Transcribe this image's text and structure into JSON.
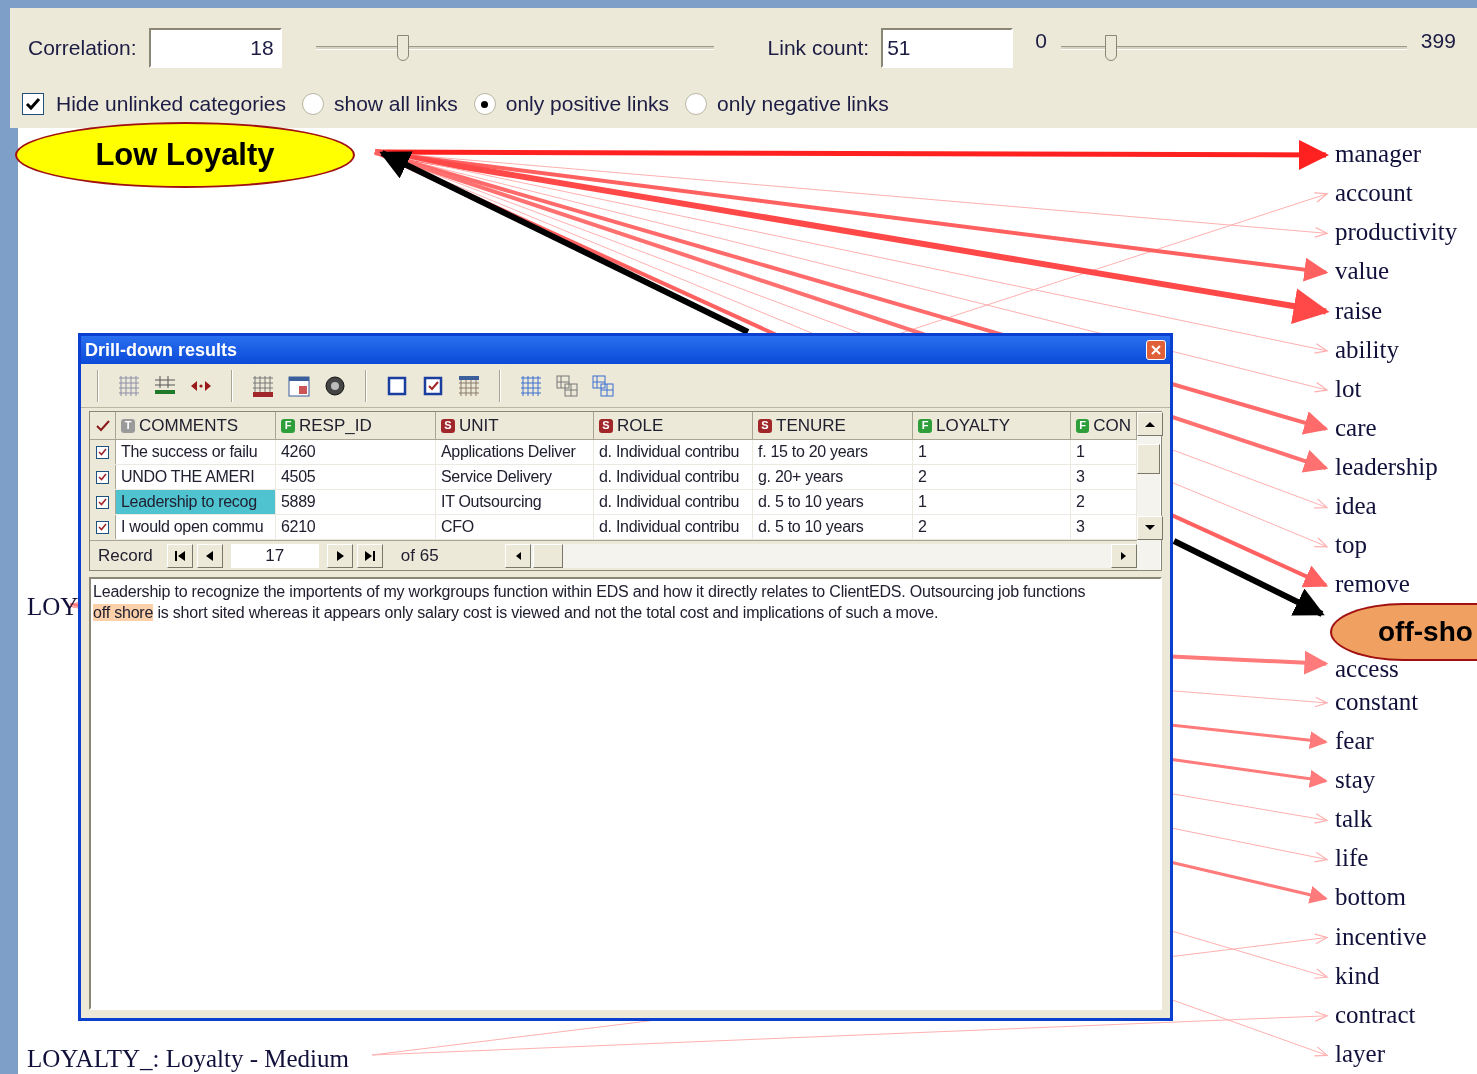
{
  "controls": {
    "correlation": {
      "label": "Correlation:",
      "value": "18",
      "level": 0.22
    },
    "link_count": {
      "label": "Link count:",
      "value": "51",
      "min": "0",
      "max": "399",
      "level": 0.145
    },
    "hide_unlinked": {
      "label": "Hide unlinked categories",
      "checked": true
    },
    "link_filter": [
      {
        "label": "show all links",
        "selected": false
      },
      {
        "label": "only positive links",
        "selected": true
      },
      {
        "label": "only negative links",
        "selected": false
      }
    ]
  },
  "graph": {
    "source_node": {
      "label": "Low Loyalty"
    },
    "side_labels": [
      {
        "text": "LOY"
      },
      {
        "text": "LOYALTY_: Loyalty - Medium"
      }
    ],
    "categories": [
      {
        "kind": "word",
        "label": "manager"
      },
      {
        "kind": "word",
        "label": "account"
      },
      {
        "kind": "word",
        "label": "productivity"
      },
      {
        "kind": "word",
        "label": "value"
      },
      {
        "kind": "word",
        "label": "raise"
      },
      {
        "kind": "word",
        "label": "ability"
      },
      {
        "kind": "word",
        "label": "lot"
      },
      {
        "kind": "word",
        "label": "care"
      },
      {
        "kind": "word",
        "label": "leadership"
      },
      {
        "kind": "word",
        "label": "idea"
      },
      {
        "kind": "word",
        "label": "top"
      },
      {
        "kind": "word",
        "label": "remove"
      },
      {
        "kind": "node",
        "label": "off-sho"
      },
      {
        "kind": "word",
        "label": "access"
      },
      {
        "kind": "word",
        "label": "constant"
      },
      {
        "kind": "word",
        "label": "fear"
      },
      {
        "kind": "word",
        "label": "stay"
      },
      {
        "kind": "word",
        "label": "talk"
      },
      {
        "kind": "word",
        "label": "life"
      },
      {
        "kind": "word",
        "label": "bottom"
      },
      {
        "kind": "word",
        "label": "incentive"
      },
      {
        "kind": "word",
        "label": "kind"
      },
      {
        "kind": "word",
        "label": "contract"
      },
      {
        "kind": "word",
        "label": "layer"
      }
    ]
  },
  "drilldown": {
    "title": "Drill-down results",
    "columns": [
      {
        "badge": "T",
        "color": "#9a9a9a",
        "label": "COMMENTS"
      },
      {
        "badge": "F",
        "color": "#2e9e3a",
        "label": "RESP_ID"
      },
      {
        "badge": "S",
        "color": "#a0262a",
        "label": "UNIT"
      },
      {
        "badge": "S",
        "color": "#a0262a",
        "label": "ROLE"
      },
      {
        "badge": "S",
        "color": "#a0262a",
        "label": "TENURE"
      },
      {
        "badge": "F",
        "color": "#2e9e3a",
        "label": "LOYALTY"
      },
      {
        "badge": "F",
        "color": "#2e9e3a",
        "label": "CON"
      }
    ],
    "rows": [
      {
        "checked": true,
        "selected": false,
        "cells": [
          "The success or failu",
          "4260",
          "Applications Deliver",
          "d. Individual contribu",
          "f. 15 to 20 years",
          "1",
          "1"
        ]
      },
      {
        "checked": true,
        "selected": false,
        "cells": [
          "UNDO THE AMERI",
          "4505",
          "Service Delivery",
          "d. Individual contribu",
          "g. 20+ years",
          "2",
          "3"
        ]
      },
      {
        "checked": true,
        "selected": true,
        "cells": [
          "Leadership to recog",
          "5889",
          "IT Outsourcing",
          "d. Individual contribu",
          "d. 5 to 10 years",
          "1",
          "2"
        ]
      },
      {
        "checked": true,
        "selected": false,
        "cells": [
          "I would open commu",
          "6210",
          "CFO",
          "d. Individual contribu",
          "d. 5 to 10 years",
          "2",
          "3"
        ]
      }
    ],
    "record_nav": {
      "label": "Record",
      "value": "17",
      "total": "of 65"
    },
    "comment": {
      "before": "Leadership to recognize the importents of my workgroups function within EDS and how it directly relates to ClientEDS. Outsourcing job functions ",
      "highlight": "off shore",
      "after": " is short sited whereas it appears only salary cost is viewed and not the total cost and implications of such a move."
    }
  }
}
